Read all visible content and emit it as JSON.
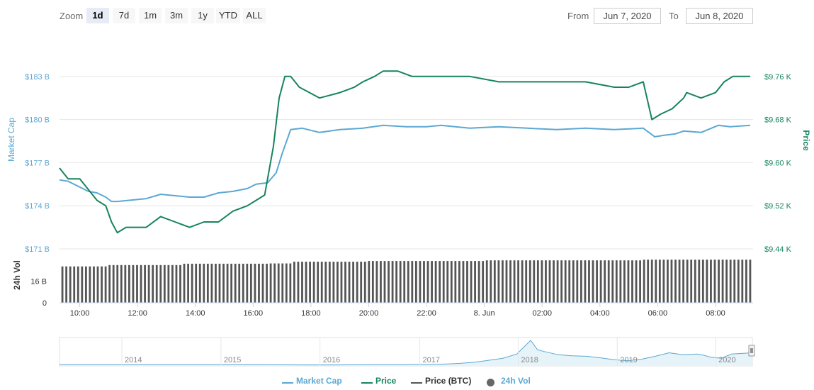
{
  "toolbar": {
    "zoom_label": "Zoom",
    "zoom_buttons": [
      {
        "label": "1d",
        "active": true
      },
      {
        "label": "7d",
        "active": false
      },
      {
        "label": "1m",
        "active": false
      },
      {
        "label": "3m",
        "active": false
      },
      {
        "label": "1y",
        "active": false
      },
      {
        "label": "YTD",
        "active": false
      },
      {
        "label": "ALL",
        "active": false
      }
    ],
    "from_label": "From",
    "from_value": "Jun 7, 2020",
    "to_label": "To",
    "to_value": "Jun 8, 2020"
  },
  "colors": {
    "market_cap": "#5ba8d3",
    "price": "#16845b",
    "price_btc": "#555555",
    "volume": "#555555",
    "grid": "#e6e6e6",
    "navigator_fill": "#e6f3f8"
  },
  "chart_data": {
    "type": "line",
    "x_axis": {
      "tick_labels": [
        "10:00",
        "12:00",
        "14:00",
        "16:00",
        "18:00",
        "20:00",
        "22:00",
        "8. Jun",
        "02:00",
        "04:00",
        "06:00",
        "08:00"
      ],
      "tick_hours": [
        10,
        12,
        14,
        16,
        18,
        20,
        22,
        24,
        26,
        28,
        30,
        32
      ],
      "range_hours": [
        9.3,
        33.3
      ]
    },
    "y_axis_left": {
      "title": "Market Cap",
      "tick_labels": [
        "$183 B",
        "$180 B",
        "$177 B",
        "$174 B",
        "$171 B"
      ],
      "ticks": [
        183,
        180,
        177,
        174,
        171
      ],
      "range": [
        171,
        186
      ]
    },
    "y_axis_right": {
      "title": "Price",
      "tick_labels": [
        "$9.76 K",
        "$9.68 K",
        "$9.60 K",
        "$9.52 K",
        "$9.44 K"
      ],
      "ticks": [
        9.76,
        9.68,
        9.6,
        9.52,
        9.44
      ],
      "range": [
        9.44,
        9.84
      ]
    },
    "volume_axis": {
      "title": "24h Vol",
      "tick_labels": [
        "16 B",
        "0"
      ],
      "ticks": [
        16,
        0
      ],
      "range": [
        0,
        40
      ]
    },
    "series": [
      {
        "name": "Market Cap",
        "axis": "left",
        "color": "#5ba8d3",
        "x": [
          9.3,
          9.6,
          10.0,
          10.3,
          10.6,
          10.9,
          11.1,
          11.3,
          11.8,
          12.3,
          12.8,
          13.3,
          13.8,
          14.3,
          14.8,
          15.3,
          15.8,
          16.1,
          16.5,
          16.8,
          17.0,
          17.3,
          17.7,
          18.3,
          19.0,
          19.8,
          20.5,
          21.3,
          22.0,
          22.5,
          23.5,
          24.5,
          25.5,
          26.5,
          27.5,
          28.5,
          29.5,
          29.9,
          30.2,
          30.6,
          30.9,
          31.5,
          32.1,
          32.5,
          33.2
        ],
        "y": [
          175.8,
          175.7,
          175.3,
          175.0,
          174.9,
          174.6,
          174.3,
          174.3,
          174.4,
          174.5,
          174.8,
          174.7,
          174.6,
          174.6,
          174.9,
          175.0,
          175.2,
          175.5,
          175.6,
          176.3,
          177.6,
          179.3,
          179.4,
          179.1,
          179.3,
          179.4,
          179.6,
          179.5,
          179.5,
          179.6,
          179.4,
          179.5,
          179.4,
          179.3,
          179.4,
          179.3,
          179.4,
          178.8,
          178.9,
          179.0,
          179.2,
          179.1,
          179.6,
          179.5,
          179.6
        ]
      },
      {
        "name": "Price",
        "axis": "right",
        "color": "#16845b",
        "x": [
          9.3,
          9.6,
          10.0,
          10.3,
          10.6,
          10.9,
          11.1,
          11.3,
          11.6,
          11.9,
          12.3,
          12.8,
          13.3,
          13.8,
          14.3,
          14.8,
          15.3,
          15.8,
          16.1,
          16.4,
          16.7,
          16.9,
          17.1,
          17.3,
          17.6,
          18.3,
          19.0,
          19.5,
          19.8,
          20.2,
          20.5,
          21.0,
          21.5,
          21.8,
          22.5,
          23.5,
          24.5,
          25.5,
          26.5,
          27.5,
          28.5,
          29.0,
          29.5,
          29.8,
          30.1,
          30.5,
          30.9,
          31.0,
          31.5,
          32.0,
          32.3,
          32.6,
          33.2
        ],
        "y": [
          9.59,
          9.57,
          9.57,
          9.55,
          9.53,
          9.52,
          9.49,
          9.47,
          9.48,
          9.48,
          9.48,
          9.5,
          9.49,
          9.48,
          9.49,
          9.49,
          9.51,
          9.52,
          9.53,
          9.54,
          9.63,
          9.72,
          9.76,
          9.76,
          9.74,
          9.72,
          9.73,
          9.74,
          9.75,
          9.76,
          9.77,
          9.77,
          9.76,
          9.76,
          9.76,
          9.76,
          9.75,
          9.75,
          9.75,
          9.75,
          9.74,
          9.74,
          9.75,
          9.68,
          9.69,
          9.7,
          9.72,
          9.73,
          9.72,
          9.73,
          9.75,
          9.76,
          9.76
        ]
      }
    ],
    "volume_bars": {
      "name": "24h Vol",
      "count": 176,
      "x_range": [
        9.4,
        33.2
      ],
      "start_value": 27,
      "step_hours": [
        11,
        13.5,
        16.5,
        17.3,
        20,
        24,
        29.5
      ],
      "step_values": [
        28,
        29,
        29.2,
        30.5,
        31,
        31.5,
        32
      ]
    },
    "navigator": {
      "year_labels": [
        "2014",
        "2015",
        "2016",
        "2017",
        "2018",
        "2019",
        "2020"
      ],
      "year_positions": [
        0.09,
        0.233,
        0.376,
        0.52,
        0.662,
        0.805,
        0.947
      ],
      "history_values": [
        0.02,
        0.02,
        0.02,
        0.02,
        0.02,
        0.01,
        0.01,
        0.02,
        0.02,
        0.03,
        0.03,
        0.05,
        0.08,
        0.12,
        0.2,
        0.28,
        0.45,
        1.0,
        0.62,
        0.55,
        0.42,
        0.38,
        0.36,
        0.3,
        0.22,
        0.18,
        0.24,
        0.36,
        0.5,
        0.42,
        0.45,
        0.4,
        0.32,
        0.28,
        0.45,
        0.5
      ],
      "history_x": [
        0.0,
        0.1,
        0.15,
        0.2,
        0.3,
        0.35,
        0.4,
        0.45,
        0.5,
        0.52,
        0.54,
        0.56,
        0.58,
        0.6,
        0.62,
        0.64,
        0.66,
        0.68,
        0.69,
        0.7,
        0.72,
        0.74,
        0.76,
        0.78,
        0.8,
        0.82,
        0.84,
        0.86,
        0.88,
        0.9,
        0.92,
        0.93,
        0.94,
        0.955,
        0.97,
        1.0
      ]
    }
  },
  "legend": {
    "items": [
      {
        "label": "Market Cap",
        "color": "#5ba8d3",
        "kind": "line"
      },
      {
        "label": "Price",
        "color": "#16845b",
        "kind": "line"
      },
      {
        "label": "Price (BTC)",
        "color": "#555555",
        "kind": "line"
      },
      {
        "label": "24h Vol",
        "color": "#666666",
        "kind": "dot"
      }
    ]
  }
}
